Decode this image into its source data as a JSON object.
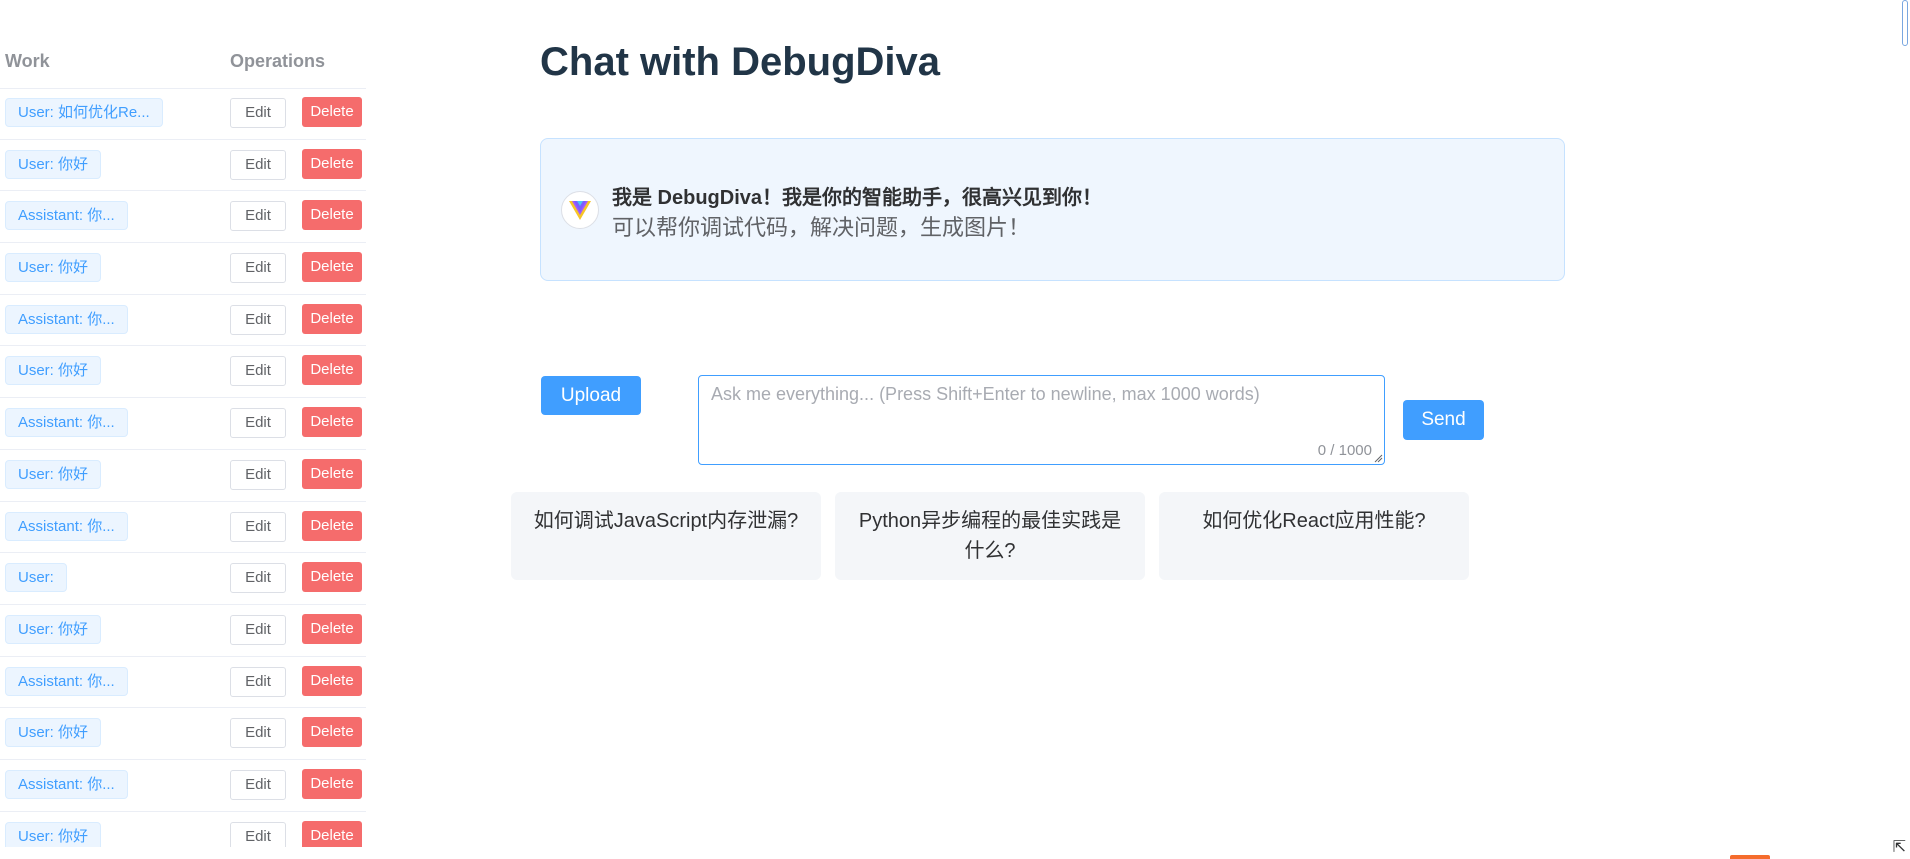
{
  "table": {
    "col_work": "Work",
    "col_operations": "Operations",
    "edit_label": "Edit",
    "delete_label": "Delete",
    "rows": [
      {
        "tag": "User: 如何优化Re..."
      },
      {
        "tag": "User: 你好"
      },
      {
        "tag": "Assistant: 你..."
      },
      {
        "tag": "User: 你好"
      },
      {
        "tag": "Assistant: 你..."
      },
      {
        "tag": "User: 你好"
      },
      {
        "tag": "Assistant: 你..."
      },
      {
        "tag": "User: 你好"
      },
      {
        "tag": "Assistant: 你..."
      },
      {
        "tag": "User:"
      },
      {
        "tag": "User: 你好"
      },
      {
        "tag": "Assistant: 你..."
      },
      {
        "tag": "User: 你好"
      },
      {
        "tag": "Assistant: 你..."
      },
      {
        "tag": "User: 你好"
      }
    ]
  },
  "main": {
    "title": "Chat with DebugDiva",
    "welcome_title": "我是 DebugDiva！我是你的智能助手，很高兴见到你！",
    "welcome_subtitle": "可以帮你调试代码，解决问题，生成图片！",
    "logo_icon": "vue-logo-icon"
  },
  "composer": {
    "upload_label": "Upload",
    "placeholder": "Ask me everything... (Press Shift+Enter to newline, max 1000 words)",
    "value": "",
    "counter": "0 / 1000",
    "send_label": "Send"
  },
  "suggestions": [
    "如何调试JavaScript内存泄漏?",
    "Python异步编程的最佳实践是什么?",
    "如何优化React应用性能?"
  ],
  "colors": {
    "primary": "#409eff",
    "danger": "#f56c6c",
    "title": "#213547"
  }
}
